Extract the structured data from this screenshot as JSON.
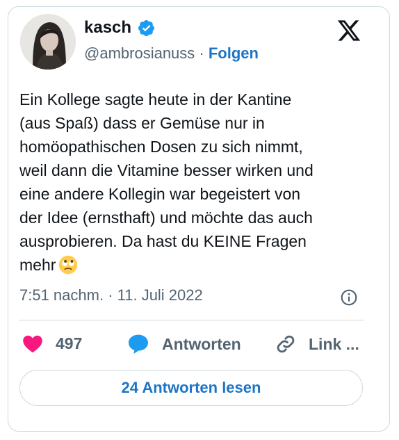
{
  "user": {
    "display_name": "kasch",
    "handle": "@ambrosianuss",
    "separator": " · ",
    "follow_label": "Folgen"
  },
  "tweet": {
    "text": "Ein Kollege sagte heute in der Kantine\n(aus Spaß) dass er Gemüse nur in\nhomöopathischen Dosen zu sich nimmt,\nweil dann die Vitamine besser wirken und\neine andere Kollegin war begeistert von\nder Idee (ernsthaft) und möchte das auch\nausprobieren. Da hast du KEINE Fragen\nmehr",
    "emoji": "face-with-rolling-eyes",
    "timestamp": "7:51 nachm. · 11. Juli 2022"
  },
  "actions": {
    "like_count": "497",
    "reply_label": "Antworten",
    "link_label": "Link ..."
  },
  "footer": {
    "read_replies_label": "24 Antworten lesen"
  },
  "colors": {
    "link_blue": "#1d74c6",
    "like_pink": "#f91880",
    "reply_blue": "#1d9bf0",
    "muted_text": "#536471",
    "border": "#cfd9de"
  }
}
